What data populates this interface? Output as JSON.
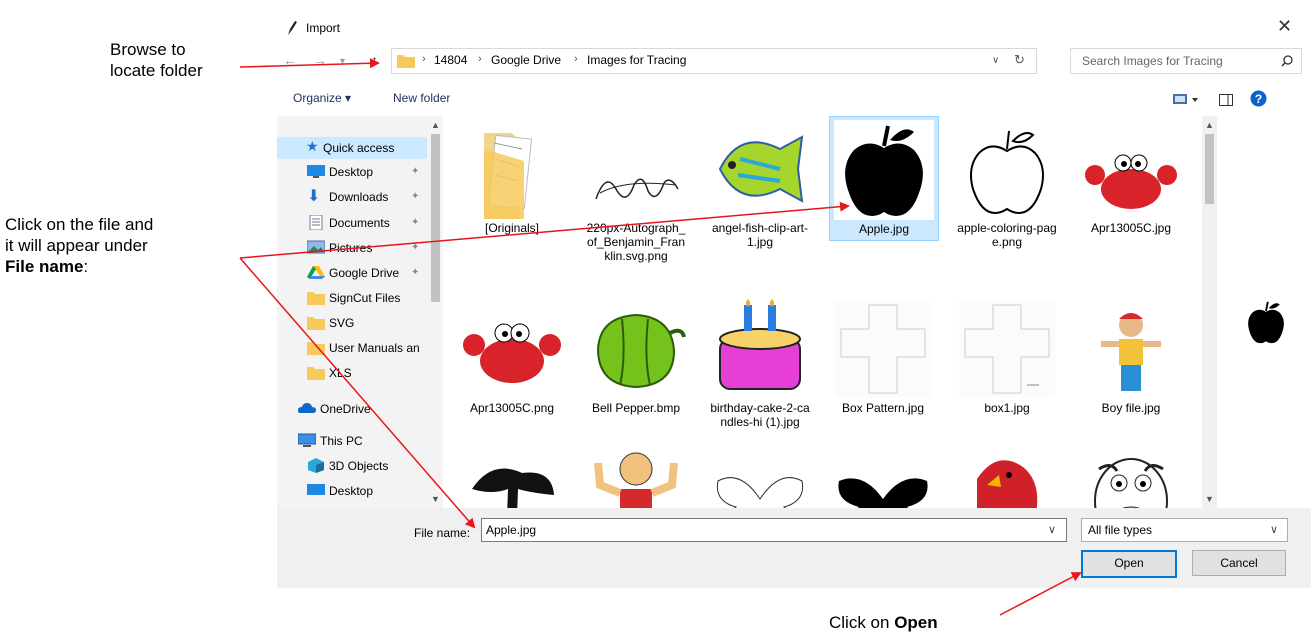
{
  "annotations": {
    "browse_line1": "Browse to",
    "browse_line2": "locate folder",
    "click_line1": "Click on the file and",
    "click_line2": "it will appear under",
    "click_line3_bold": "File name",
    "click_line3_rest": ":",
    "open_prefix": "Click on ",
    "open_bold": "Open",
    "arrow_color": "#e8151b"
  },
  "dialog": {
    "title": "Import",
    "close_glyph": "✕",
    "address": [
      "14804",
      "Google Drive",
      "Images for Tracing"
    ],
    "search_placeholder": "Search Images for Tracing",
    "organize_label": "Organize ▾",
    "new_folder_label": "New folder",
    "nav_items": [
      {
        "label": "Quick access",
        "icon": "star-icon"
      },
      {
        "label": "Desktop",
        "icon": "desktop-icon",
        "pinned": true
      },
      {
        "label": "Downloads",
        "icon": "download-icon",
        "pinned": true
      },
      {
        "label": "Documents",
        "icon": "document-icon",
        "pinned": true
      },
      {
        "label": "Pictures",
        "icon": "pictures-icon",
        "pinned": true
      },
      {
        "label": "Google Drive",
        "icon": "google-drive-icon",
        "pinned": true
      },
      {
        "label": "SignCut Files",
        "icon": "folder-icon"
      },
      {
        "label": "SVG",
        "icon": "folder-icon"
      },
      {
        "label": "User Manuals an",
        "icon": "folder-icon"
      },
      {
        "label": "XLS",
        "icon": "folder-icon"
      },
      {
        "label": "OneDrive",
        "icon": "onedrive-icon"
      },
      {
        "label": "This PC",
        "icon": "pc-icon"
      },
      {
        "label": "3D Objects",
        "icon": "3d-objects-icon"
      },
      {
        "label": "Desktop",
        "icon": "desktop-icon"
      }
    ],
    "files_row1": [
      "[Originals]",
      "220px-Autograph_of_Benjamin_Franklin.svg.png",
      "angel-fish-clip-art-1.jpg",
      "Apple.jpg",
      "apple-coloring-page.png",
      "Apr13005C.jpg"
    ],
    "files_row2": [
      "Apr13005C.png",
      "Bell Pepper.bmp",
      "birthday-cake-2-candles-hi (1).jpg",
      "Box Pattern.jpg",
      "box1.jpg",
      "Boy file.jpg"
    ],
    "file_name_label": "File name:",
    "file_name_value": "Apple.jpg",
    "file_type_value": "All file types",
    "open_label": "Open",
    "cancel_label": "Cancel",
    "accent": "#0078d7",
    "selection": "#cce8ff"
  }
}
